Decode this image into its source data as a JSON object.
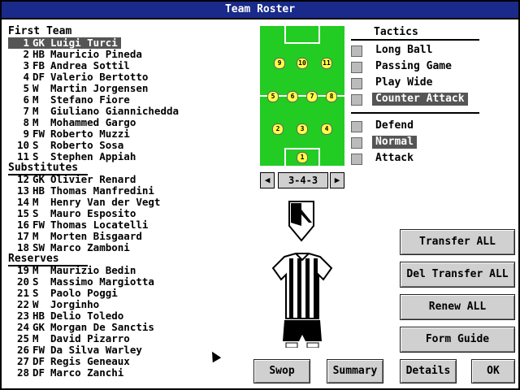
{
  "title": "Team Roster",
  "sections": {
    "first_team": "First Team",
    "substitutes": "Substitutes",
    "reserves": "Reserves"
  },
  "first_team": [
    {
      "num": "1",
      "pos": "GK",
      "name": "Luigi Turci"
    },
    {
      "num": "2",
      "pos": "HB",
      "name": "Mauricio Pineda"
    },
    {
      "num": "3",
      "pos": "FB",
      "name": "Andrea Sottil"
    },
    {
      "num": "4",
      "pos": "DF",
      "name": "Valerio Bertotto"
    },
    {
      "num": "5",
      "pos": "W",
      "name": "Martin Jorgensen"
    },
    {
      "num": "6",
      "pos": "M",
      "name": "Stefano Fiore"
    },
    {
      "num": "7",
      "pos": "M",
      "name": "Giuliano Giannichedda"
    },
    {
      "num": "8",
      "pos": "M",
      "name": "Mohammed Gargo"
    },
    {
      "num": "9",
      "pos": "FW",
      "name": "Roberto Muzzi"
    },
    {
      "num": "10",
      "pos": "S",
      "name": "Roberto Sosa"
    },
    {
      "num": "11",
      "pos": "S",
      "name": "Stephen Appiah"
    }
  ],
  "substitutes": [
    {
      "num": "12",
      "pos": "GK",
      "name": "Olivier Renard"
    },
    {
      "num": "13",
      "pos": "HB",
      "name": "Thomas Manfredini"
    },
    {
      "num": "14",
      "pos": "M",
      "name": "Henry Van der Vegt"
    },
    {
      "num": "15",
      "pos": "S",
      "name": "Mauro Esposito"
    },
    {
      "num": "16",
      "pos": "FW",
      "name": "Thomas Locatelli"
    },
    {
      "num": "17",
      "pos": "M",
      "name": "Morten Bisgaard"
    },
    {
      "num": "18",
      "pos": "SW",
      "name": "Marco Zamboni"
    }
  ],
  "reserves": [
    {
      "num": "19",
      "pos": "M",
      "name": "Maurizio Bedin"
    },
    {
      "num": "20",
      "pos": "S",
      "name": "Massimo Margiotta"
    },
    {
      "num": "21",
      "pos": "S",
      "name": "Paolo Poggi"
    },
    {
      "num": "22",
      "pos": "W",
      "name": "Jorginho"
    },
    {
      "num": "23",
      "pos": "HB",
      "name": "Delio Toledo"
    },
    {
      "num": "24",
      "pos": "GK",
      "name": "Morgan De Sanctis"
    },
    {
      "num": "25",
      "pos": "M",
      "name": "David Pizarro"
    },
    {
      "num": "26",
      "pos": "FW",
      "name": "Da Silva Warley"
    },
    {
      "num": "27",
      "pos": "DF",
      "name": "Regis Geneaux"
    },
    {
      "num": "28",
      "pos": "DF",
      "name": "Marco Zanchi"
    }
  ],
  "formation": {
    "label": "3-4-3",
    "player_dots": [
      "9",
      "10",
      "11",
      "5",
      "6",
      "7",
      "8",
      "2",
      "3",
      "4",
      "1"
    ]
  },
  "tactics": {
    "title": "Tactics",
    "styles": [
      "Long Ball",
      "Passing Game",
      "Play Wide",
      "Counter Attack"
    ],
    "selected_style": "Counter Attack",
    "modes": [
      "Defend",
      "Normal",
      "Attack"
    ],
    "selected_mode": "Normal"
  },
  "buttons": {
    "transfer_all": "Transfer ALL",
    "del_transfer_all": "Del Transfer ALL",
    "renew_all": "Renew ALL",
    "form_guide": "Form Guide",
    "swop": "Swop",
    "summary": "Summary",
    "details": "Details",
    "ok": "OK"
  },
  "colors": {
    "title_bar": "#1a2a8a",
    "pitch": "#22cc22",
    "player_dot": "#ffff44",
    "selection": "#555555",
    "button": "#d0d0d0"
  }
}
